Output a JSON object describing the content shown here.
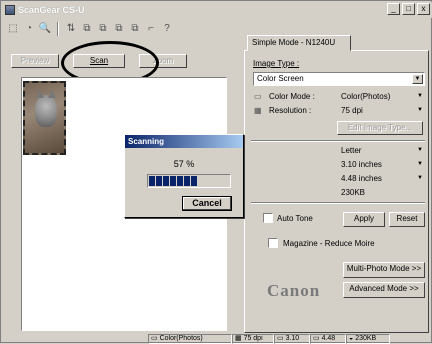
{
  "window": {
    "title": "ScanGear CS-U",
    "minimize": "_",
    "maximize": "□",
    "close": "x"
  },
  "toolbar": [
    "⬚",
    "◔",
    "🔍",
    "⇅",
    "⧉",
    "⧉",
    "⧉",
    "⧉",
    "⌐",
    "?"
  ],
  "left": {
    "preview_label": "Preview",
    "scan_label": "Scan",
    "zoom_label": "Zoom"
  },
  "right": {
    "tab_label": "Simple Mode - N1240U",
    "image_type_label": "Image Type :",
    "image_type_value": "Color Screen",
    "color_mode_label": "Color Mode :",
    "color_mode_value": "Color(Photos)",
    "resolution_label": "Resolution :",
    "resolution_value": "75 dpi",
    "edit_image_type": "Edit Image Type...",
    "paper_value": "Letter",
    "width_value": "3.10 inches",
    "height_value": "4.48 inches",
    "size_value": "230KB",
    "auto_tone": "Auto Tone",
    "apply": "Apply",
    "reset": "Reset",
    "magazine": "Magazine - Reduce Moire",
    "multi_photo": "Multi-Photo Mode >>",
    "advanced": "Advanced Mode >>",
    "brand": "Canon"
  },
  "dialog": {
    "title": "Scanning",
    "percent_text": "57 %",
    "progress": 0.57,
    "cancel": "Cancel"
  },
  "status": {
    "color_mode": "Color(Photos)",
    "resolution": "75 dpi",
    "width": "3.10",
    "height": "4.48",
    "size": "230KB"
  }
}
